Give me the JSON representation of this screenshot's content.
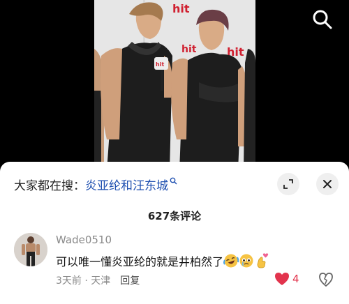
{
  "video": {
    "banner_texts": [
      "hit",
      "hit",
      "hit"
    ],
    "mic_label": "hit"
  },
  "icons": {
    "search": "search-icon",
    "magnifier_small": "search-small-icon",
    "expand": "expand-icon",
    "close": "close-icon",
    "like": "heart-icon",
    "dislike": "broken-heart-icon"
  },
  "search_suggestion": {
    "prefix": "大家都在搜：",
    "query": "炎亚纶和汪东城"
  },
  "comments_header": {
    "count_label": "627条评论"
  },
  "comment": {
    "username": "Wade0510",
    "text": "可以唯一懂炎亚纶的就是井柏然了",
    "emojis": [
      "laughing-crying-emoji",
      "pleading-emoji",
      "finger-heart-emoji"
    ],
    "time": "3天前",
    "separator": " · ",
    "location": "天津",
    "reply_label": "回复",
    "like_count": "4"
  },
  "colors": {
    "link": "#1e4fb0",
    "like": "#e2344d",
    "muted": "#8a8a8a"
  }
}
